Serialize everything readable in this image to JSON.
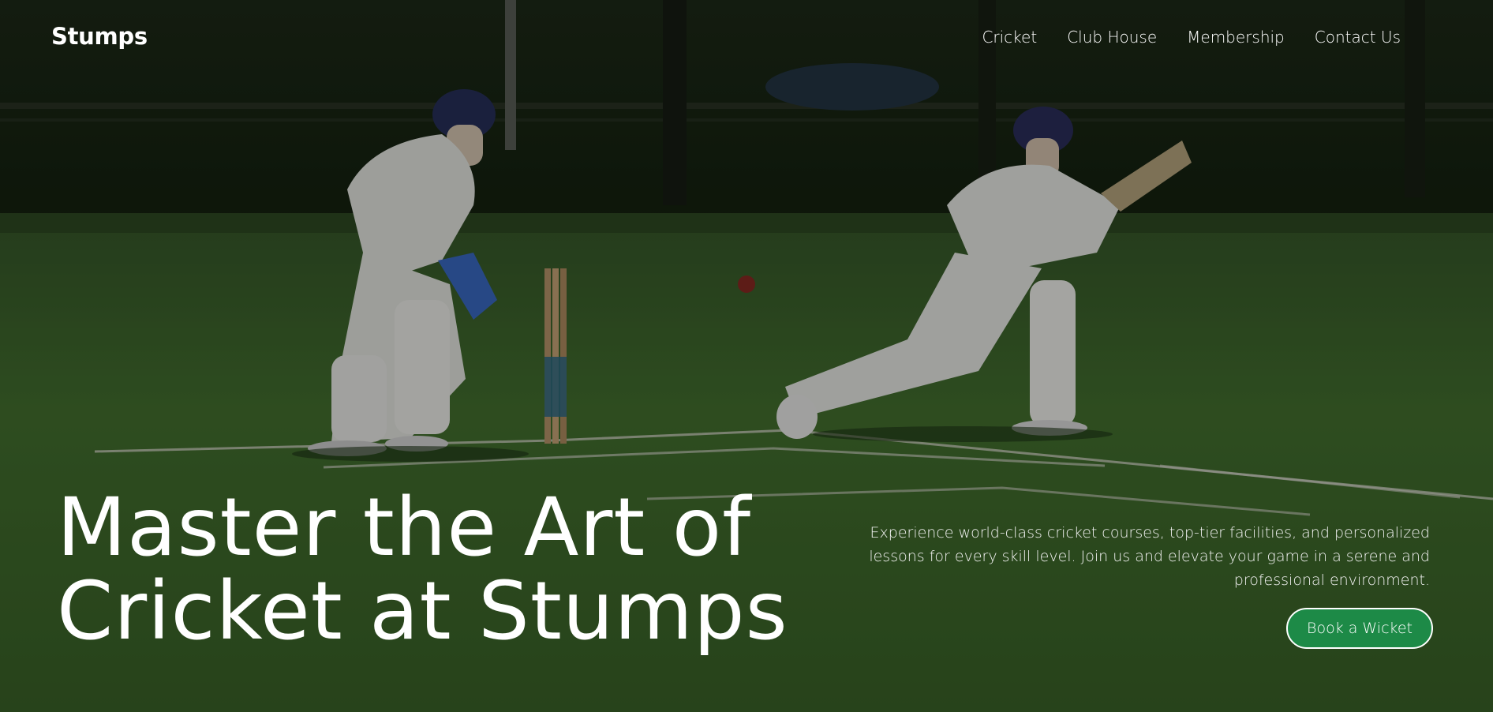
{
  "brand": {
    "logo": "Stumps"
  },
  "nav": {
    "items": [
      {
        "label": "Cricket"
      },
      {
        "label": "Club House"
      },
      {
        "label": "Membership"
      },
      {
        "label": "Contact Us"
      }
    ]
  },
  "hero": {
    "headline_line1": "Master the Art of",
    "headline_line2": "Cricket at Stumps",
    "tagline": "Experience world-class cricket courses, top-tier facilities, and personalized lessons for every skill level. Join us and elevate your game in a serene and professional environment.",
    "cta_label": "Book a Wicket"
  },
  "colors": {
    "accent": "#1d8a47",
    "text": "#ffffff",
    "grass": "#3f6b2c"
  }
}
